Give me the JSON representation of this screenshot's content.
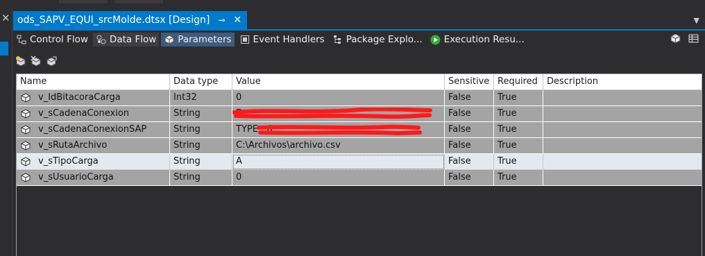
{
  "document_tab": {
    "title": "ods_SAPV_EQUI_srcMolde.dtsx [Design]",
    "pin_glyph": "⊸",
    "close_glyph": "✕"
  },
  "designer_tabs": [
    {
      "label": "Control Flow",
      "icon": "control-flow-icon"
    },
    {
      "label": "Data Flow",
      "icon": "data-flow-icon"
    },
    {
      "label": "Parameters",
      "icon": "parameters-icon"
    },
    {
      "label": "Event Handlers",
      "icon": "event-handlers-icon"
    },
    {
      "label": "Package Explo...",
      "icon": "package-explorer-icon"
    },
    {
      "label": "Execution Resu...",
      "icon": "execution-results-icon"
    }
  ],
  "grid": {
    "columns": [
      "Name",
      "Data type",
      "Value",
      "Sensitive",
      "Required",
      "Description"
    ],
    "rows": [
      {
        "name": "v_IdBitacoraCarga",
        "type": "Int32",
        "value": "0",
        "sensitive": "False",
        "required": "True",
        "description": ""
      },
      {
        "name": "v_sCadenaConexion",
        "type": "String",
        "value": "D",
        "sensitive": "False",
        "required": "True",
        "description": ""
      },
      {
        "name": "v_sCadenaConexionSAP",
        "type": "String",
        "value": "TYPE...6...",
        "sensitive": "False",
        "required": "True",
        "description": ""
      },
      {
        "name": "v_sRutaArchivo",
        "type": "String",
        "value": "C:\\Archivos\\archivo.csv",
        "sensitive": "False",
        "required": "True",
        "description": ""
      },
      {
        "name": "v_sTipoCarga",
        "type": "String",
        "value": "A",
        "sensitive": "False",
        "required": "True",
        "description": ""
      },
      {
        "name": "v_sUsuarioCarga",
        "type": "String",
        "value": "0",
        "sensitive": "False",
        "required": "True",
        "description": ""
      }
    ],
    "selected_row": 4
  },
  "colors": {
    "accent": "#007acc",
    "redaction": "#ff1a1a"
  }
}
